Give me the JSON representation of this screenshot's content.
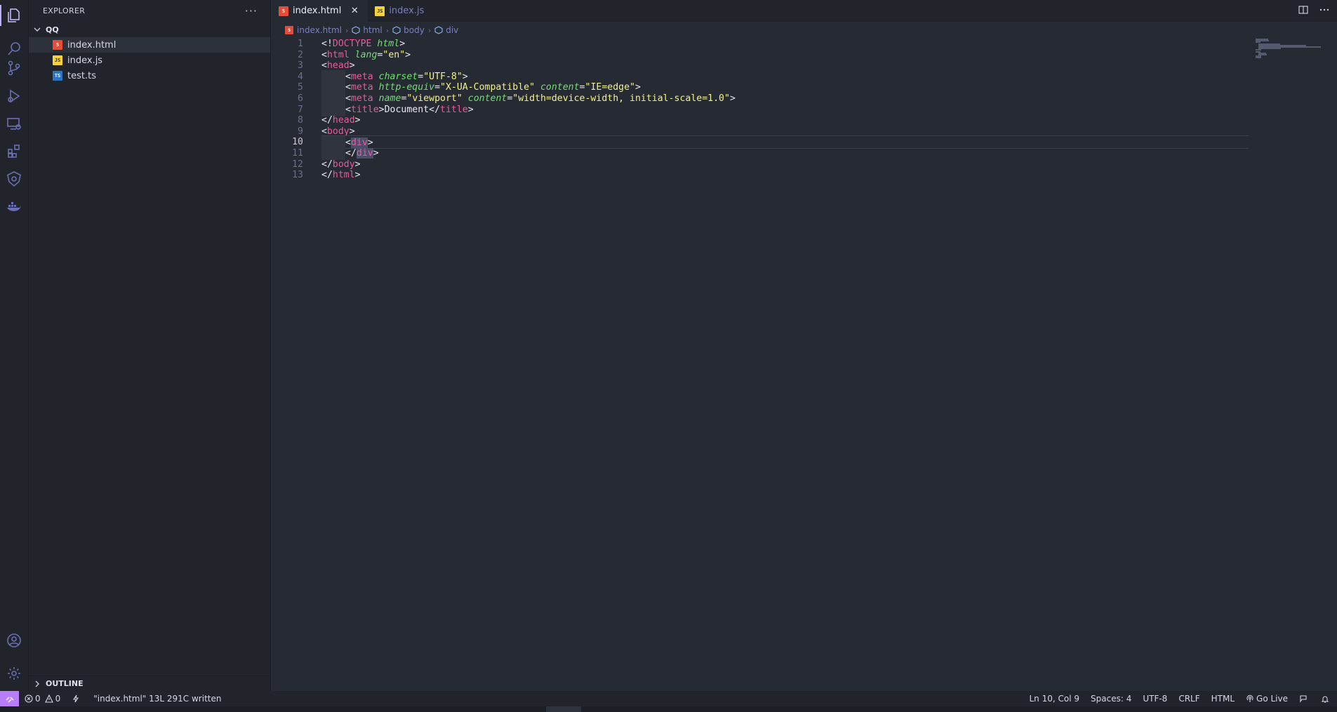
{
  "sidebar": {
    "title": "EXPLORER",
    "more": "···",
    "folder": "QQ",
    "files": [
      {
        "name": "index.html",
        "icon": "html-file-icon",
        "badge": "5"
      },
      {
        "name": "index.js",
        "icon": "js-file-icon",
        "badge": "JS"
      },
      {
        "name": "test.ts",
        "icon": "ts-file-icon",
        "badge": "TS"
      }
    ],
    "outline": "OUTLINE"
  },
  "tabs": [
    {
      "label": "index.html",
      "active": true,
      "close": "✕"
    },
    {
      "label": "index.js",
      "active": false
    }
  ],
  "breadcrumb": {
    "file": "index.html",
    "items": [
      "html",
      "body",
      "div"
    ]
  },
  "editor": {
    "lines": [
      {
        "n": "1",
        "tokens": [
          [
            "punc",
            "<!"
          ],
          [
            "doctype",
            "DOCTYPE"
          ],
          [
            "punc",
            " "
          ],
          [
            "attr",
            "html"
          ],
          [
            "punc",
            ">"
          ]
        ]
      },
      {
        "n": "2",
        "tokens": [
          [
            "punc",
            "<"
          ],
          [
            "tag",
            "html"
          ],
          [
            "punc",
            " "
          ],
          [
            "attr",
            "lang"
          ],
          [
            "punc",
            "="
          ],
          [
            "str",
            "\"en\""
          ],
          [
            "punc",
            ">"
          ]
        ]
      },
      {
        "n": "3",
        "tokens": [
          [
            "punc",
            "<"
          ],
          [
            "tag",
            "head"
          ],
          [
            "punc",
            ">"
          ]
        ]
      },
      {
        "n": "4",
        "indent": 1,
        "tokens": [
          [
            "punc",
            "<"
          ],
          [
            "tag",
            "meta"
          ],
          [
            "punc",
            " "
          ],
          [
            "attr",
            "charset"
          ],
          [
            "punc",
            "="
          ],
          [
            "str",
            "\"UTF-8\""
          ],
          [
            "punc",
            ">"
          ]
        ]
      },
      {
        "n": "5",
        "indent": 1,
        "tokens": [
          [
            "punc",
            "<"
          ],
          [
            "tag",
            "meta"
          ],
          [
            "punc",
            " "
          ],
          [
            "attr",
            "http-equiv"
          ],
          [
            "punc",
            "="
          ],
          [
            "str",
            "\"X-UA-Compatible\""
          ],
          [
            "punc",
            " "
          ],
          [
            "attr",
            "content"
          ],
          [
            "punc",
            "="
          ],
          [
            "str",
            "\"IE=edge\""
          ],
          [
            "punc",
            ">"
          ]
        ]
      },
      {
        "n": "6",
        "indent": 1,
        "tokens": [
          [
            "punc",
            "<"
          ],
          [
            "tag",
            "meta"
          ],
          [
            "punc",
            " "
          ],
          [
            "attr",
            "name"
          ],
          [
            "punc",
            "="
          ],
          [
            "str",
            "\"viewport\""
          ],
          [
            "punc",
            " "
          ],
          [
            "attr",
            "content"
          ],
          [
            "punc",
            "="
          ],
          [
            "str",
            "\"width=device-width, initial-scale=1.0\""
          ],
          [
            "punc",
            ">"
          ]
        ]
      },
      {
        "n": "7",
        "indent": 1,
        "tokens": [
          [
            "punc",
            "<"
          ],
          [
            "tag",
            "title"
          ],
          [
            "punc",
            ">"
          ],
          [
            "text",
            "Document"
          ],
          [
            "punc",
            "</"
          ],
          [
            "tag",
            "title"
          ],
          [
            "punc",
            ">"
          ]
        ]
      },
      {
        "n": "8",
        "tokens": [
          [
            "punc",
            "</"
          ],
          [
            "tag",
            "head"
          ],
          [
            "punc",
            ">"
          ]
        ]
      },
      {
        "n": "9",
        "tokens": [
          [
            "punc",
            "<"
          ],
          [
            "tag",
            "body"
          ],
          [
            "punc",
            ">"
          ]
        ]
      },
      {
        "n": "10",
        "indent": 1,
        "current": true,
        "tokens": [
          [
            "punc",
            "<"
          ],
          [
            "taghl",
            "div"
          ],
          [
            "punc",
            ">"
          ]
        ]
      },
      {
        "n": "11",
        "indent": 1,
        "tokens": [
          [
            "punc",
            "</"
          ],
          [
            "taghl",
            "div"
          ],
          [
            "punc",
            ">"
          ]
        ]
      },
      {
        "n": "12",
        "tokens": [
          [
            "punc",
            "</"
          ],
          [
            "tag",
            "body"
          ],
          [
            "punc",
            ">"
          ]
        ]
      },
      {
        "n": "13",
        "tokens": [
          [
            "punc",
            "</"
          ],
          [
            "tag",
            "html"
          ],
          [
            "punc",
            ">"
          ]
        ]
      }
    ]
  },
  "statusbar": {
    "errors": "0",
    "warnings": "0",
    "message": "\"index.html\" 13L 291C written",
    "position": "Ln 10, Col 9",
    "spaces": "Spaces: 4",
    "encoding": "UTF-8",
    "eol": "CRLF",
    "language": "HTML",
    "golive": "Go Live"
  },
  "colors": {
    "accent": "#b97dfc",
    "background": "#262a33",
    "sidebar": "#21252b"
  }
}
